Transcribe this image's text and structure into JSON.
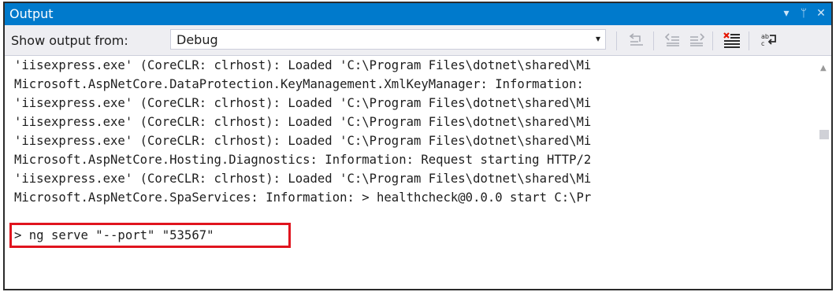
{
  "panel": {
    "title": "Output"
  },
  "window_buttons": {
    "dropdown_icon": "chevron-down-icon",
    "pin_icon": "pin-icon",
    "close_icon": "close-icon",
    "dropdown_glyph": "▾",
    "pin_glyph": "ᛘ",
    "close_glyph": "✕"
  },
  "toolbar": {
    "show_output_label": "Show output from:",
    "source_selected": "Debug",
    "dropdown_arrow": "▾",
    "buttons": [
      {
        "name": "find-message-in-code-button",
        "icon": "goto-source-icon"
      },
      {
        "name": "previous-message-button",
        "icon": "previous-message-icon"
      },
      {
        "name": "next-message-button",
        "icon": "next-message-icon"
      },
      {
        "name": "clear-all-button",
        "icon": "clear-all-icon"
      },
      {
        "name": "toggle-word-wrap-button",
        "icon": "word-wrap-icon"
      }
    ]
  },
  "output": {
    "lines": [
      "'iisexpress.exe' (CoreCLR: clrhost): Loaded 'C:\\Program Files\\dotnet\\shared\\Mi",
      "Microsoft.AspNetCore.DataProtection.KeyManagement.XmlKeyManager: Information:",
      "'iisexpress.exe' (CoreCLR: clrhost): Loaded 'C:\\Program Files\\dotnet\\shared\\Mi",
      "'iisexpress.exe' (CoreCLR: clrhost): Loaded 'C:\\Program Files\\dotnet\\shared\\Mi",
      "'iisexpress.exe' (CoreCLR: clrhost): Loaded 'C:\\Program Files\\dotnet\\shared\\Mi",
      "Microsoft.AspNetCore.Hosting.Diagnostics: Information: Request starting HTTP/2",
      "'iisexpress.exe' (CoreCLR: clrhost): Loaded 'C:\\Program Files\\dotnet\\shared\\Mi",
      "Microsoft.AspNetCore.SpaServices: Information: > healthcheck@0.0.0 start C:\\Pr",
      "> ng serve \"--port\" \"53567\""
    ]
  },
  "scrollbar": {
    "up_arrow": "▲"
  },
  "colors": {
    "title_bar": "#007acc",
    "toolbar_bg": "#eeeef2",
    "highlight_border": "#e0141e"
  }
}
